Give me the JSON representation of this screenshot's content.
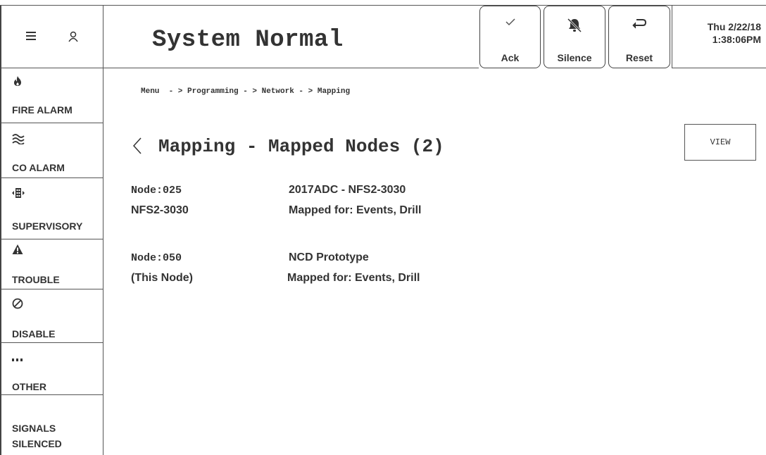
{
  "header": {
    "title": "System Normal",
    "buttons": {
      "ack": "Ack",
      "silence": "Silence",
      "reset": "Reset"
    },
    "date": "Thu 2/22/18",
    "time": "1:38:06PM"
  },
  "sidebar": {
    "items": [
      {
        "label": "FIRE ALARM",
        "icon": "flame-icon"
      },
      {
        "label": "CO ALARM",
        "icon": "waves-icon"
      },
      {
        "label": "SUPERVISORY",
        "icon": "building-icon"
      },
      {
        "label": "TROUBLE",
        "icon": "warning-icon"
      },
      {
        "label": "DISABLE",
        "icon": "prohibited-icon"
      },
      {
        "label": "OTHER",
        "icon": "dots-icon"
      }
    ],
    "signals_line1": "SIGNALS",
    "signals_line2": "SILENCED"
  },
  "main": {
    "breadcrumb": "Menu  - > Programming - > Network - > Mapping",
    "page_title": "Mapping - Mapped Nodes (2)",
    "view_label": "VIEW",
    "nodes": [
      {
        "id": "Node:025",
        "model": "NFS2-3030",
        "name": "2017ADC - NFS2-3030",
        "mapped": "Mapped for: Events, Drill"
      },
      {
        "id": "Node:050",
        "model": "(This Node)",
        "name": "NCD Prototype",
        "mapped": "Mapped for: Events, Drill"
      }
    ]
  }
}
